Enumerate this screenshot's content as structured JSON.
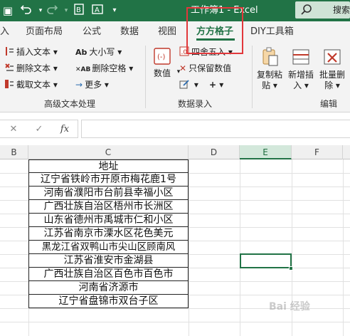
{
  "titlebar": {
    "title": "工作簿1 - Excel",
    "search_label": "搜索",
    "icons": [
      "undo-icon",
      "redo-icon",
      "excel-kit-icon",
      "text-box-icon"
    ]
  },
  "tabs": {
    "items": [
      "入",
      "页面布局",
      "公式",
      "数据",
      "视图",
      "方方格子",
      "DIY工具箱"
    ],
    "active": "方方格子"
  },
  "ribbon": {
    "text_group": {
      "label": "高级文本处理",
      "insert_text": "插入文本",
      "delete_text": "删除文本",
      "extract_text": "截取文本",
      "case": "大小写",
      "delete_space": "删除空格",
      "more": "更多"
    },
    "data_group": {
      "label": "数据录入",
      "numeric": "数值",
      "round": "四舍五入",
      "keep_value": "只保留数值",
      "plus": "+"
    },
    "edit_group": {
      "label": "编辑",
      "copy_paste_1": "复制粘",
      "copy_paste_2": "贴",
      "new_insert_1": "新增插",
      "new_insert_2": "入",
      "batch_delete_1": "批量删",
      "batch_delete_2": "除"
    }
  },
  "formula_bar": {
    "cancel": "✕",
    "confirm": "✓",
    "fx": "fx",
    "value": ""
  },
  "grid": {
    "columns": [
      "B",
      "C",
      "D",
      "E",
      "F"
    ],
    "selected_column": "E",
    "header": "地址",
    "rows": [
      "辽宁省铁岭市开原市梅花鹿1号",
      "河南省濮阳市台前县幸福小区",
      "广西壮族自治区梧州市长洲区",
      "山东省德州市禹城市仁和小区",
      "江苏省南京市溧水区花色美元",
      "黑龙江省双鸭山市尖山区顾南风",
      "江苏省淮安市金湖县",
      "广西壮族自治区百色市百色市",
      "河南省济源市",
      "辽宁省盘锦市双台子区"
    ]
  },
  "watermark": "Bai 经验",
  "colors": {
    "excel_green": "#217346",
    "highlight_red": "#e2383b"
  }
}
